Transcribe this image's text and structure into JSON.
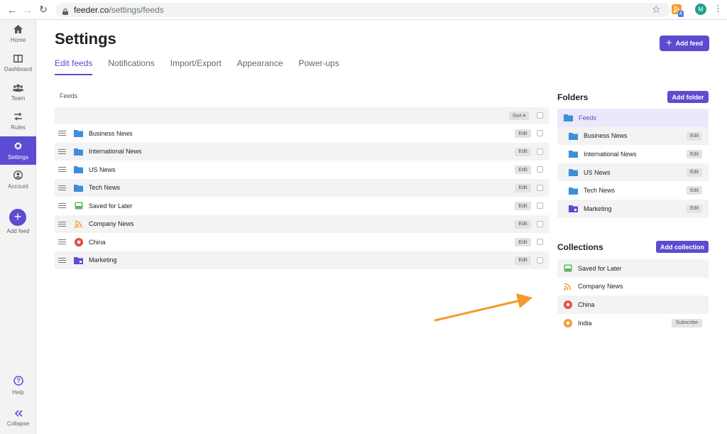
{
  "browser": {
    "url_domain": "feeder.co",
    "url_path": "/settings/feeds",
    "ext_badge": "4",
    "profile_initial": "M"
  },
  "sidebar": {
    "items": [
      {
        "label": "Home",
        "icon": "home-icon"
      },
      {
        "label": "Dashboard",
        "icon": "dashboard-icon"
      },
      {
        "label": "Team",
        "icon": "team-icon"
      },
      {
        "label": "Rules",
        "icon": "rules-icon"
      },
      {
        "label": "Settings",
        "icon": "gear-icon",
        "active": true
      },
      {
        "label": "Account",
        "icon": "account-icon"
      }
    ],
    "add_feed_label": "Add feed",
    "help_label": "Help",
    "collapse_label": "Collapse"
  },
  "page": {
    "title": "Settings",
    "add_feed_button": "Add feed"
  },
  "tabs": [
    {
      "label": "Edit feeds",
      "active": true
    },
    {
      "label": "Notifications"
    },
    {
      "label": "Import/Export"
    },
    {
      "label": "Appearance"
    },
    {
      "label": "Power-ups"
    }
  ],
  "feeds": {
    "caption": "Feeds",
    "sort_label": "Sort ▾",
    "edit_label": "Edit",
    "rows": [
      {
        "name": "Business News",
        "icon": "folder-blue"
      },
      {
        "name": "International News",
        "icon": "folder-blue"
      },
      {
        "name": "US News",
        "icon": "folder-blue"
      },
      {
        "name": "Tech News",
        "icon": "folder-blue"
      },
      {
        "name": "Saved for Later",
        "icon": "inbox-green"
      },
      {
        "name": "Company News",
        "icon": "rss-orange"
      },
      {
        "name": "China",
        "icon": "star-red"
      },
      {
        "name": "Marketing",
        "icon": "folder-purple"
      }
    ]
  },
  "folders": {
    "title": "Folders",
    "add_button": "Add folder",
    "root": "Feeds",
    "edit_label": "Edit",
    "items": [
      {
        "name": "Business News",
        "icon": "folder-blue"
      },
      {
        "name": "International News",
        "icon": "folder-blue"
      },
      {
        "name": "US News",
        "icon": "folder-blue"
      },
      {
        "name": "Tech News",
        "icon": "folder-blue"
      },
      {
        "name": "Marketing",
        "icon": "folder-purple"
      }
    ]
  },
  "collections": {
    "title": "Collections",
    "add_button": "Add collection",
    "subscribe_label": "Subscribe",
    "items": [
      {
        "name": "Saved for Later",
        "icon": "inbox-green"
      },
      {
        "name": "Company News",
        "icon": "rss-orange"
      },
      {
        "name": "China",
        "icon": "star-red"
      },
      {
        "name": "India",
        "icon": "star-orange",
        "subscribe": true
      }
    ]
  },
  "colors": {
    "accent": "#5c4cd1",
    "folder_blue": "#3d8fd6",
    "folder_purple": "#5c4cd1",
    "green": "#5cb85c",
    "rss": "#f29b2e",
    "red": "#e34b3b",
    "arrow": "#f39a2b"
  }
}
